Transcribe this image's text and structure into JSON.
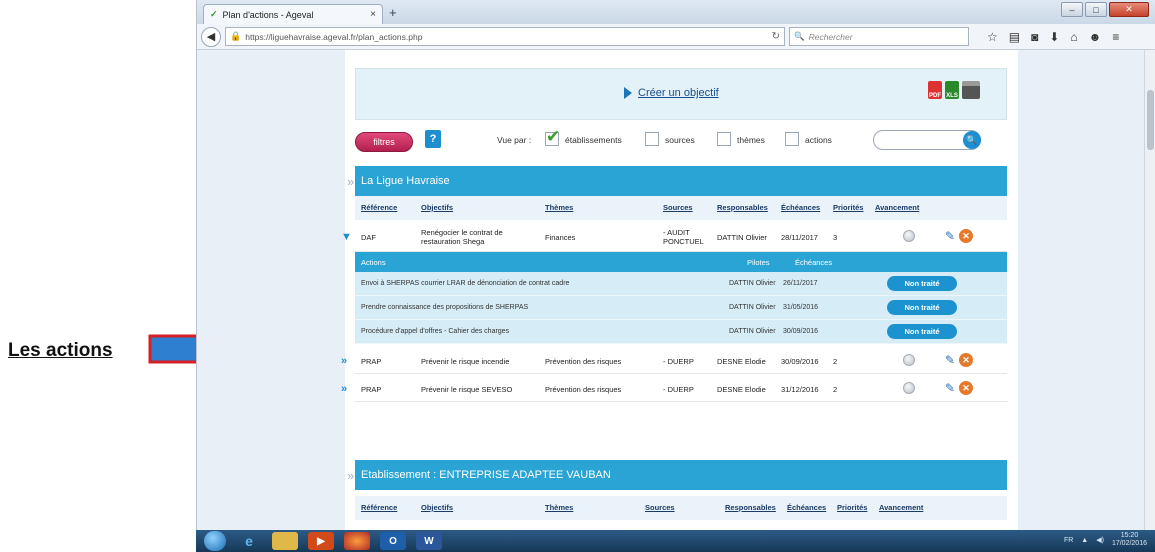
{
  "callout": {
    "label": "Les actions"
  },
  "browser": {
    "tab_title": "Plan d'actions - Ageval",
    "tab_close": "×",
    "new_tab": "+",
    "url": "https://liguehavraise.ageval.fr/plan_actions.php",
    "search_placeholder": "Rechercher",
    "win_minimize": "–",
    "win_maximize": "□",
    "win_close": "✕"
  },
  "page": {
    "create_link": "Créer un objectif",
    "filter_button": "filtres",
    "help": "?",
    "vue_par": "Vue par :",
    "view_options": [
      "établissements",
      "sources",
      "thèmes",
      "actions"
    ],
    "export_pdf": "PDF",
    "export_xls": "XLS"
  },
  "columns": {
    "reference": "Référence",
    "objectifs": "Objectifs",
    "themes": "Thèmes",
    "sources": "Sources",
    "responsables": "Responsables",
    "echeances": "Échéances",
    "priorites": "Priorités",
    "avancement": "Avancement"
  },
  "group1": {
    "title": "La Ligue Havraise",
    "rows": [
      {
        "ref": "DAF",
        "objectif": "Renégocier le contrat de restauration Shega",
        "theme": "Finances",
        "source": "- AUDIT PONCTUEL",
        "responsable": "DATTIN Olivier",
        "echeance": "28/11/2017",
        "priorite": "3"
      },
      {
        "ref": "PRAP",
        "objectif": "Prévenir le risque incendie",
        "theme": "Prévention des risques",
        "source": "- DUERP",
        "responsable": "DESNE Elodie",
        "echeance": "30/09/2016",
        "priorite": "2"
      },
      {
        "ref": "PRAP",
        "objectif": "Prévenir le risque SEVESO",
        "theme": "Prévention des risques",
        "source": "- DUERP",
        "responsable": "DESNE Elodie",
        "echeance": "31/12/2016",
        "priorite": "2"
      }
    ],
    "actions_header": {
      "actions": "Actions",
      "pilotes": "Pilotes",
      "echeances": "Échéances"
    },
    "actions": [
      {
        "label": "Envoi à SHERPAS courrier LRAR de dénonciation de contrat cadre",
        "pilote": "DATTIN Olivier",
        "echeance": "26/11/2017",
        "status": "Non traité"
      },
      {
        "label": "Prendre connaissance des propositions de SHERPAS",
        "pilote": "DATTIN Olivier",
        "echeance": "31/05/2016",
        "status": "Non traité"
      },
      {
        "label": "Procédure d'appel d'offres - Cahier des charges",
        "pilote": "DATTIN Olivier",
        "echeance": "30/09/2016",
        "status": "Non traité"
      }
    ]
  },
  "group2": {
    "title": "Etablissement : ENTREPRISE ADAPTEE VAUBAN"
  },
  "taskbar": {
    "lang": "FR",
    "time": "15:20",
    "date": "17/02/2016"
  },
  "colors": {
    "accent": "#2aa4d4",
    "filter_button": "#c2285a",
    "status_button": "#1c93d0",
    "callout_arrow": "#2f7fd0"
  }
}
